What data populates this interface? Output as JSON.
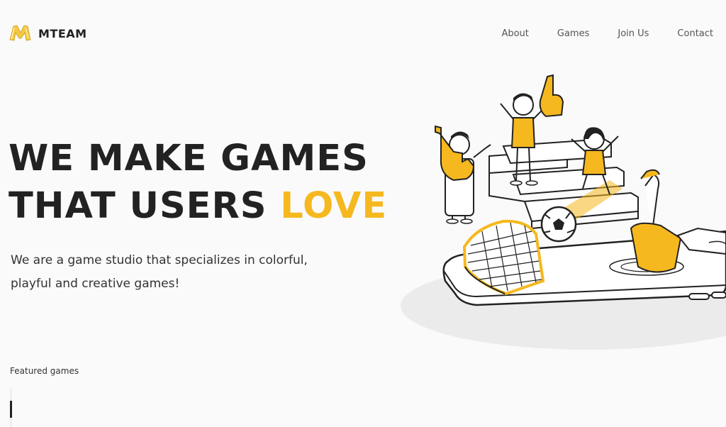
{
  "header": {
    "brand": "MTEAM",
    "nav": [
      "About",
      "Games",
      "Join Us",
      "Contact"
    ]
  },
  "hero": {
    "title_line1": "WE MAKE GAMES",
    "title_line2_prefix": "THAT USERS ",
    "title_line2_accent": "LOVE",
    "description_line1": "We are a game studio that specializes in colorful,",
    "description_line2": "playful and creative games!"
  },
  "featured": {
    "label": "Featured games"
  },
  "colors": {
    "accent": "#f5b81e",
    "text": "#222222",
    "background": "#fafafa"
  },
  "icons": {
    "logo": "m-logo-icon",
    "illustration": "stadium-phone-illustration"
  }
}
